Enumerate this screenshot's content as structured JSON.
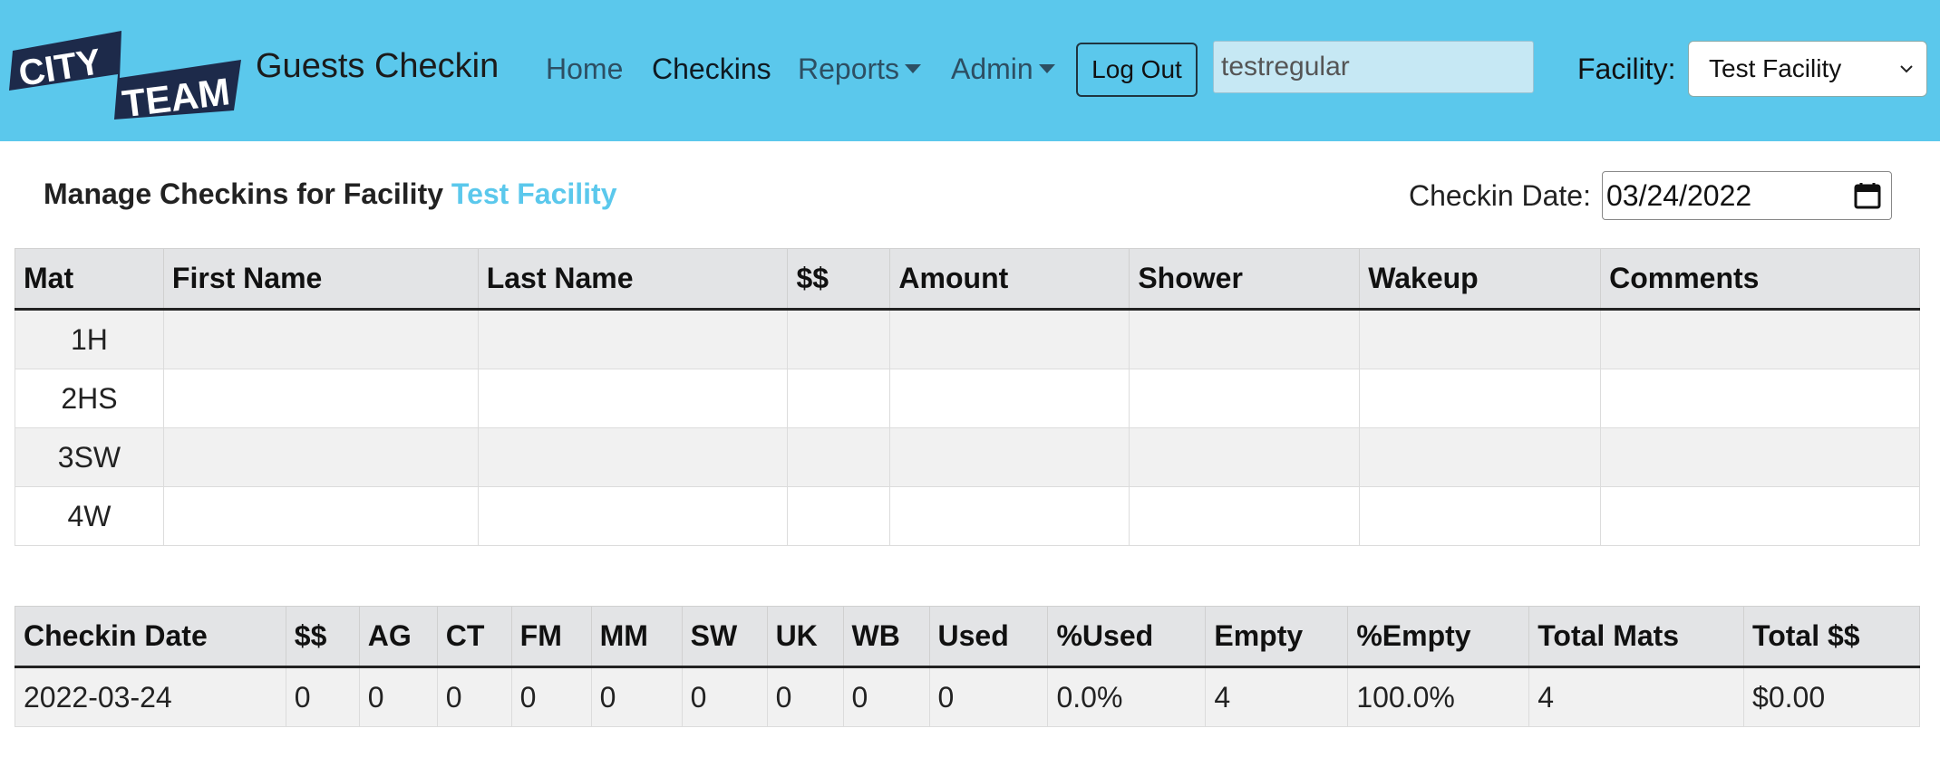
{
  "app": {
    "logo_text": "CITY TEAM",
    "brand": "Guests Checkin"
  },
  "nav": {
    "home": "Home",
    "checkins": "Checkins",
    "reports": "Reports",
    "admin": "Admin",
    "logout": "Log Out",
    "username": "testregular",
    "facility_label": "Facility:",
    "facility_selected": "Test Facility"
  },
  "page": {
    "heading_prefix": "Manage Checkins for Facility",
    "heading_facility": "Test Facility",
    "checkin_date_label": "Checkin Date:",
    "checkin_date_value": "03/24/2022"
  },
  "mats_table": {
    "headers": [
      "Mat",
      "First Name",
      "Last Name",
      "$$",
      "Amount",
      "Shower",
      "Wakeup",
      "Comments"
    ],
    "rows": [
      [
        "1H",
        "",
        "",
        "",
        "",
        "",
        "",
        ""
      ],
      [
        "2HS",
        "",
        "",
        "",
        "",
        "",
        "",
        ""
      ],
      [
        "3SW",
        "",
        "",
        "",
        "",
        "",
        "",
        ""
      ],
      [
        "4W",
        "",
        "",
        "",
        "",
        "",
        "",
        ""
      ]
    ]
  },
  "summary_table": {
    "headers": [
      "Checkin Date",
      "$$",
      "AG",
      "CT",
      "FM",
      "MM",
      "SW",
      "UK",
      "WB",
      "Used",
      "%Used",
      "Empty",
      "%Empty",
      "Total Mats",
      "Total $$"
    ],
    "rows": [
      [
        "2022-03-24",
        "0",
        "0",
        "0",
        "0",
        "0",
        "0",
        "0",
        "0",
        "0",
        "0.0%",
        "4",
        "100.0%",
        "4",
        "$0.00"
      ]
    ]
  },
  "colors": {
    "navbar": "#5bc8ec",
    "accent": "#5bc8ec",
    "logo_dark": "#1d2a4a"
  }
}
